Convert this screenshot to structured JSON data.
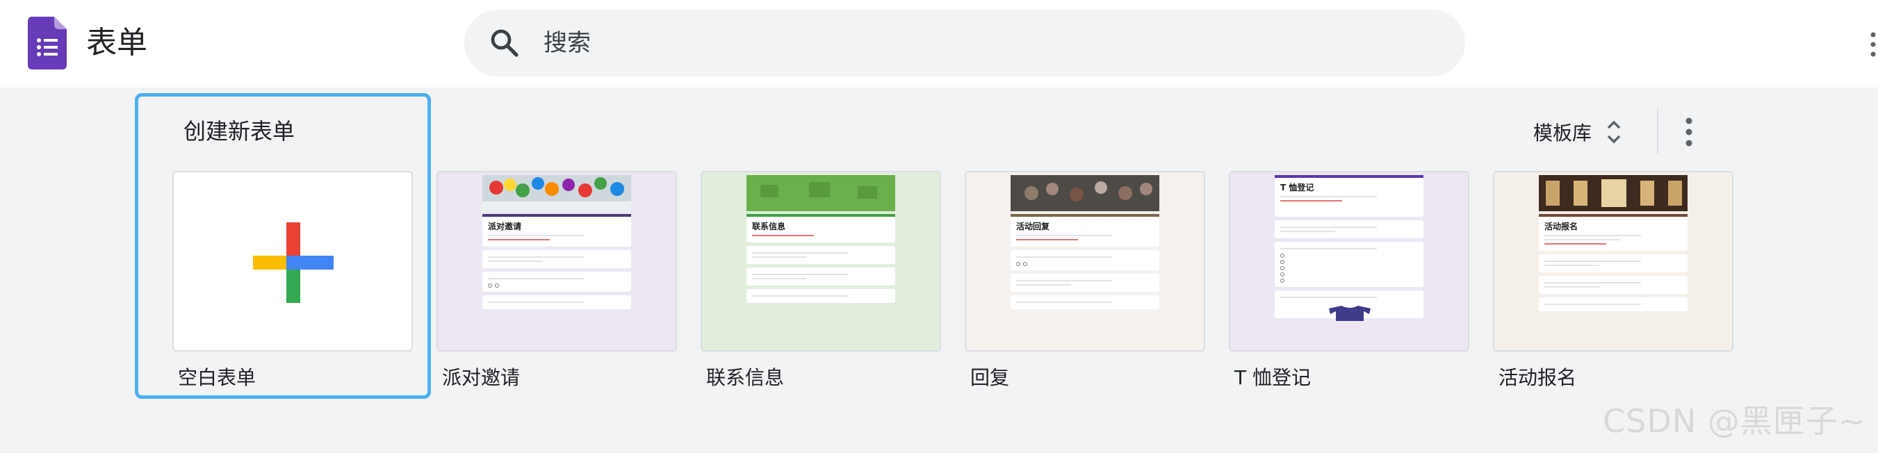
{
  "app": {
    "title": "表单",
    "accent": "#673ab7"
  },
  "search": {
    "placeholder": "搜索"
  },
  "gallery": {
    "create_title": "创建新表单",
    "toggle_label": "模板库",
    "templates": [
      {
        "label": "空白表单",
        "tile_bg": "#ffffff"
      },
      {
        "label": "派对邀请",
        "tile_bg": "#ece7f3",
        "preview_title": "派对邀请",
        "accent": "#4a3a7a"
      },
      {
        "label": "联系信息",
        "tile_bg": "#e1eedd",
        "preview_title": "联系信息",
        "accent": "#43a047"
      },
      {
        "label": "回复",
        "tile_bg": "#f4f1ee",
        "preview_title": "活动回复",
        "accent": "#7a6650"
      },
      {
        "label": "T 恤登记",
        "tile_bg": "#ece7f3",
        "preview_title": "T 恤登记",
        "accent": "#5e35b1"
      },
      {
        "label": "活动报名",
        "tile_bg": "#f5efea",
        "preview_title": "活动报名",
        "accent": "#6d4c3b"
      }
    ]
  },
  "watermark": "CSDN @黑匣子~"
}
